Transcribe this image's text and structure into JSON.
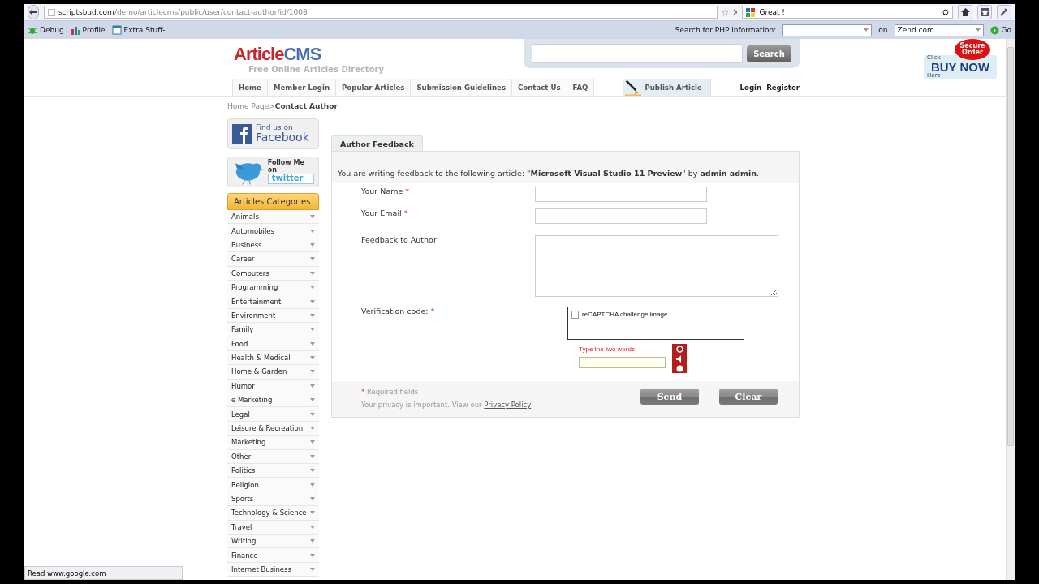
{
  "browser": {
    "url_host": "scriptsbud.com",
    "url_path": "/demo/articlecms/public/user/contact-author/id/1008",
    "search_text": "Great !",
    "toolbar": [
      {
        "label": "Debug",
        "kind": "bug"
      },
      {
        "label": "Profile",
        "kind": "chart"
      },
      {
        "label": "Extra Stuff-",
        "kind": "window"
      }
    ],
    "php_search": {
      "label": "Search for PHP information:",
      "on": "on",
      "site": "Zend.com",
      "go": "Go"
    }
  },
  "header": {
    "logo_a": "Article",
    "logo_b": "CMS",
    "tagline": "Free Online Articles Directory",
    "search_button": "Search"
  },
  "ad": {
    "badge_1": "Secure",
    "badge_2": "Order",
    "click": "Click",
    "main": "BUY NOW",
    "here": "Here"
  },
  "nav": [
    {
      "label": "Home",
      "kind": "tab"
    },
    {
      "label": "Member Login",
      "kind": "tab"
    },
    {
      "label": "Popular Articles",
      "kind": "tab"
    },
    {
      "label": "Submission Guidelines",
      "kind": "tab"
    },
    {
      "label": "Contact Us",
      "kind": "tab"
    },
    {
      "label": "FAQ",
      "kind": "tab"
    },
    {
      "label": "Publish Article",
      "kind": "publish"
    }
  ],
  "account": [
    "Login",
    "Register"
  ],
  "breadcrumb": {
    "home": "Home Page",
    "sep": ">",
    "current": "Contact Author"
  },
  "social": {
    "facebook_1": "Find us on",
    "facebook_2": "Facebook",
    "twitter_1": "Follow Me on",
    "twitter_2": "twitter"
  },
  "categories": {
    "title": "Articles Categories",
    "items": [
      "Animals",
      "Automobiles",
      "Business",
      "Career",
      "Computers",
      "Programming",
      "Entertainment",
      "Environment",
      "Family",
      "Food",
      "Health & Medical",
      "Home & Garden",
      "Humor",
      "e Marketing",
      "Legal",
      "Leisure & Recreation",
      "Marketing",
      "Other",
      "Politics",
      "Religion",
      "Sports",
      "Technology & Science",
      "Travel",
      "Writing",
      "Finance",
      "Internet Business"
    ]
  },
  "form": {
    "tab": "Author Feedback",
    "intro": "You are writing feedback to the following article: \"**Microsoft Visual Studio 11 Preview**\" by **admin admin**.",
    "required_mark": "*",
    "fields": [
      {
        "label": "Your Name",
        "required": true,
        "kind": "input"
      },
      {
        "label": "Your Email",
        "required": true,
        "kind": "input"
      },
      {
        "label": "Feedback to Author",
        "required": false,
        "kind": "textarea"
      },
      {
        "label": "Verification code:",
        "required": true,
        "kind": "captcha"
      }
    ],
    "captcha": {
      "image_alt": "reCAPTCHA challenge image",
      "prompt": "Type the two words"
    },
    "required_note": "Required fields",
    "privacy": "Your privacy is important. View our ",
    "privacy_link": "Privacy Policy",
    "buttons": [
      "Send",
      "Clear"
    ]
  },
  "status": "Read www.google.com"
}
